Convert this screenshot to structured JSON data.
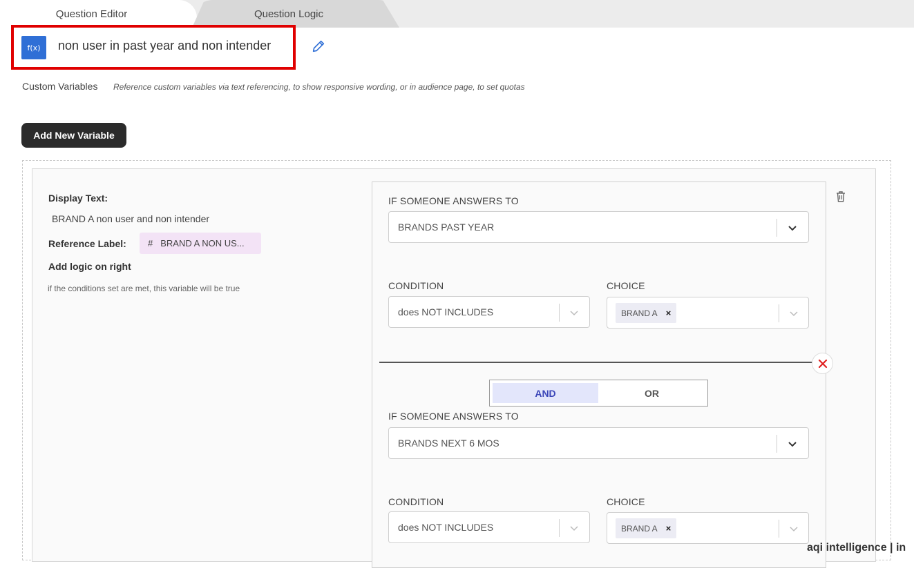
{
  "tabs": [
    {
      "label": "Question Editor",
      "active": true
    },
    {
      "label": "Question Logic",
      "active": false
    }
  ],
  "variable": {
    "icon": "f(x)",
    "name": "non user in past year and non intender"
  },
  "custom_variables": {
    "label": "Custom Variables",
    "description": "Reference custom variables via text referencing, to show responsive wording, or in audience page, to set quotas"
  },
  "add_button": "Add New Variable",
  "left_panel": {
    "display_text_label": "Display Text:",
    "display_text_value": "BRAND A non user and non intender",
    "reference_label": "Reference Label:",
    "reference_chip_hash": "#",
    "reference_chip_value": "BRAND A NON US...",
    "add_logic_label": "Add logic on right",
    "hint": "if the conditions set are met, this variable will be true"
  },
  "rules": [
    {
      "question_label": "IF SOMEONE ANSWERS TO",
      "question_value": "BRANDS PAST YEAR",
      "condition_label": "CONDITION",
      "condition_value": "does NOT INCLUDES",
      "choice_label": "CHOICE",
      "choice_chip": "BRAND A",
      "choice_remove": "×"
    },
    {
      "question_label": "IF SOMEONE ANSWERS TO",
      "question_value": "BRANDS NEXT 6 MOS",
      "condition_label": "CONDITION",
      "condition_value": "does NOT INCLUDES",
      "choice_label": "CHOICE",
      "choice_chip": "BRAND A",
      "choice_remove": "×"
    }
  ],
  "connector": {
    "and_label": "AND",
    "or_label": "OR",
    "selected": "AND"
  },
  "footer_logo": "aqi intelligence | in",
  "colors": {
    "accent_blue": "#2f6fd6",
    "highlight_red": "#e00000",
    "and_active_bg": "#e3e6fb",
    "reference_chip_bg": "#f3e3f6"
  }
}
